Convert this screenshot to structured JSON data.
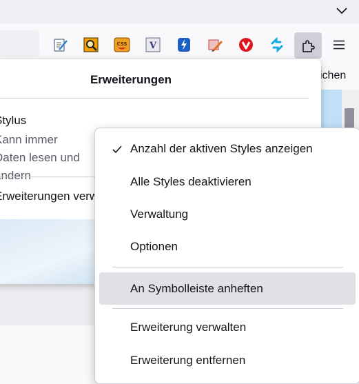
{
  "toolbar": {
    "extension_icons": [
      "stylus-icon",
      "magnifier-icon",
      "css-icon",
      "v-icon",
      "bolt-icon",
      "pen-icon",
      "vivaldi-icon",
      "sync-arrows-icon",
      "puzzle-icon",
      "hamburger-menu-icon"
    ]
  },
  "bookmarks": {
    "partial_text": "ichen"
  },
  "panel": {
    "title": "Erweiterungen",
    "extension": {
      "name": "Stylus",
      "description": "Kann immer Daten lesen und ändern"
    },
    "manage_link": "Erweiterungen verwalten"
  },
  "context_menu": {
    "items": [
      {
        "label": "Anzahl der aktiven Styles anzeigen",
        "checked": true
      },
      {
        "label": "Alle Styles deaktivieren"
      },
      {
        "label": "Verwaltung"
      },
      {
        "label": "Optionen"
      },
      {
        "label": "An Symbolleiste anheften",
        "highlighted": true
      },
      {
        "label": "Erweiterung verwalten"
      },
      {
        "label": "Erweiterung entfernen"
      }
    ]
  },
  "colors": {
    "accent": "#0060df",
    "menu_hover": "#e0e0e6",
    "active_button": "#cfcfd8"
  }
}
